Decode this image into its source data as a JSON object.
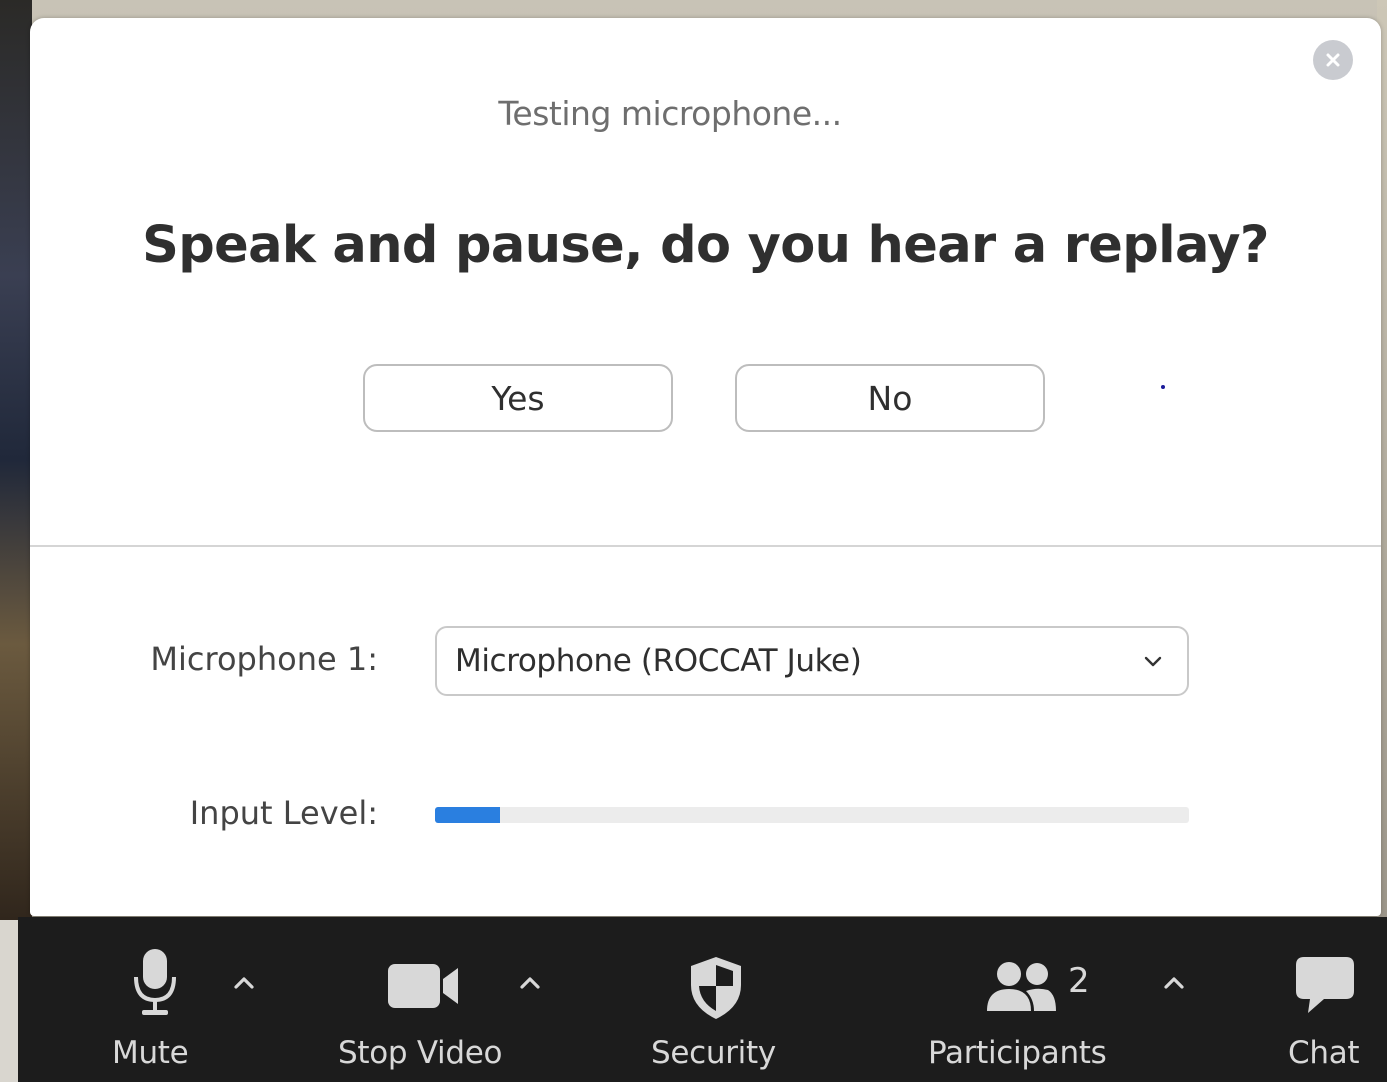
{
  "dialog": {
    "status": "Testing microphone...",
    "question": "Speak and pause, do you hear a replay?",
    "yes_label": "Yes",
    "no_label": "No",
    "microphone_label": "Microphone 1:",
    "microphone_value": "Microphone (ROCCAT Juke)",
    "input_level_label": "Input Level:",
    "input_level_fraction": 0.086
  },
  "toolbar": {
    "mute_label": "Mute",
    "stop_video_label": "Stop Video",
    "security_label": "Security",
    "participants_label": "Participants",
    "participants_count": "2",
    "chat_label": "Chat"
  },
  "colors": {
    "level_fill": "#2a7fe0",
    "toolbar_bg": "#1c1c1c",
    "toolbar_text": "#d8d8d8"
  },
  "icons": [
    "close-icon",
    "chevron-down-icon",
    "microphone-icon",
    "caret-up-icon",
    "video-camera-icon",
    "shield-icon",
    "participants-icon",
    "chat-bubble-icon"
  ]
}
